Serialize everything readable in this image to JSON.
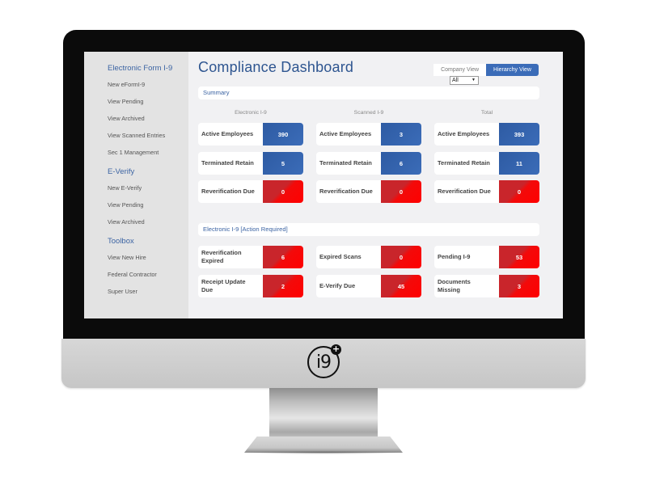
{
  "sidebar": {
    "sections": [
      {
        "heading": "Electronic Form I-9",
        "links": [
          "New eFormI-9",
          "View Pending",
          "View Archived",
          "View Scanned Entries",
          "Sec 1 Management"
        ]
      },
      {
        "heading": "E-Verify",
        "links": [
          "New E-Verify",
          "View Pending",
          "View Archived"
        ]
      },
      {
        "heading": "Toolbox",
        "links": [
          "View New Hire",
          "Federal Contractor",
          "Super User"
        ]
      }
    ]
  },
  "header": {
    "title": "Compliance Dashboard",
    "view_toggle": {
      "company": "Company View",
      "hierarchy": "Hierarchy View",
      "active": "Hierarchy View"
    },
    "scope_select": {
      "selected": "All"
    }
  },
  "summary": {
    "title": "Summary",
    "columns": [
      "Electronic I-9",
      "Scanned I-9",
      "Total"
    ],
    "rows": [
      {
        "label": "Active Employees",
        "values": [
          "390",
          "3",
          "393"
        ],
        "status": "blue"
      },
      {
        "label": "Terminated Retain",
        "values": [
          "5",
          "6",
          "11"
        ],
        "status": "blue"
      },
      {
        "label": "Reverification Due",
        "values": [
          "0",
          "0",
          "0"
        ],
        "status": "red"
      }
    ]
  },
  "action_required": {
    "title": "Electronic I-9 [Action Required]",
    "cards": [
      {
        "label": "Reverification Expired",
        "value": "6"
      },
      {
        "label": "Expired Scans",
        "value": "0"
      },
      {
        "label": "Pending I-9",
        "value": "53"
      },
      {
        "label": "Receipt Update Due",
        "value": "2"
      },
      {
        "label": "E-Verify Due",
        "value": "45"
      },
      {
        "label": "Documents Missing",
        "value": "3"
      }
    ]
  },
  "branding": {
    "logo_text": "i9",
    "logo_badge": "+"
  },
  "colors": {
    "accent_blue": "#3b6cb8",
    "alert_red": "#e8141a",
    "title_blue": "#2e5590"
  }
}
